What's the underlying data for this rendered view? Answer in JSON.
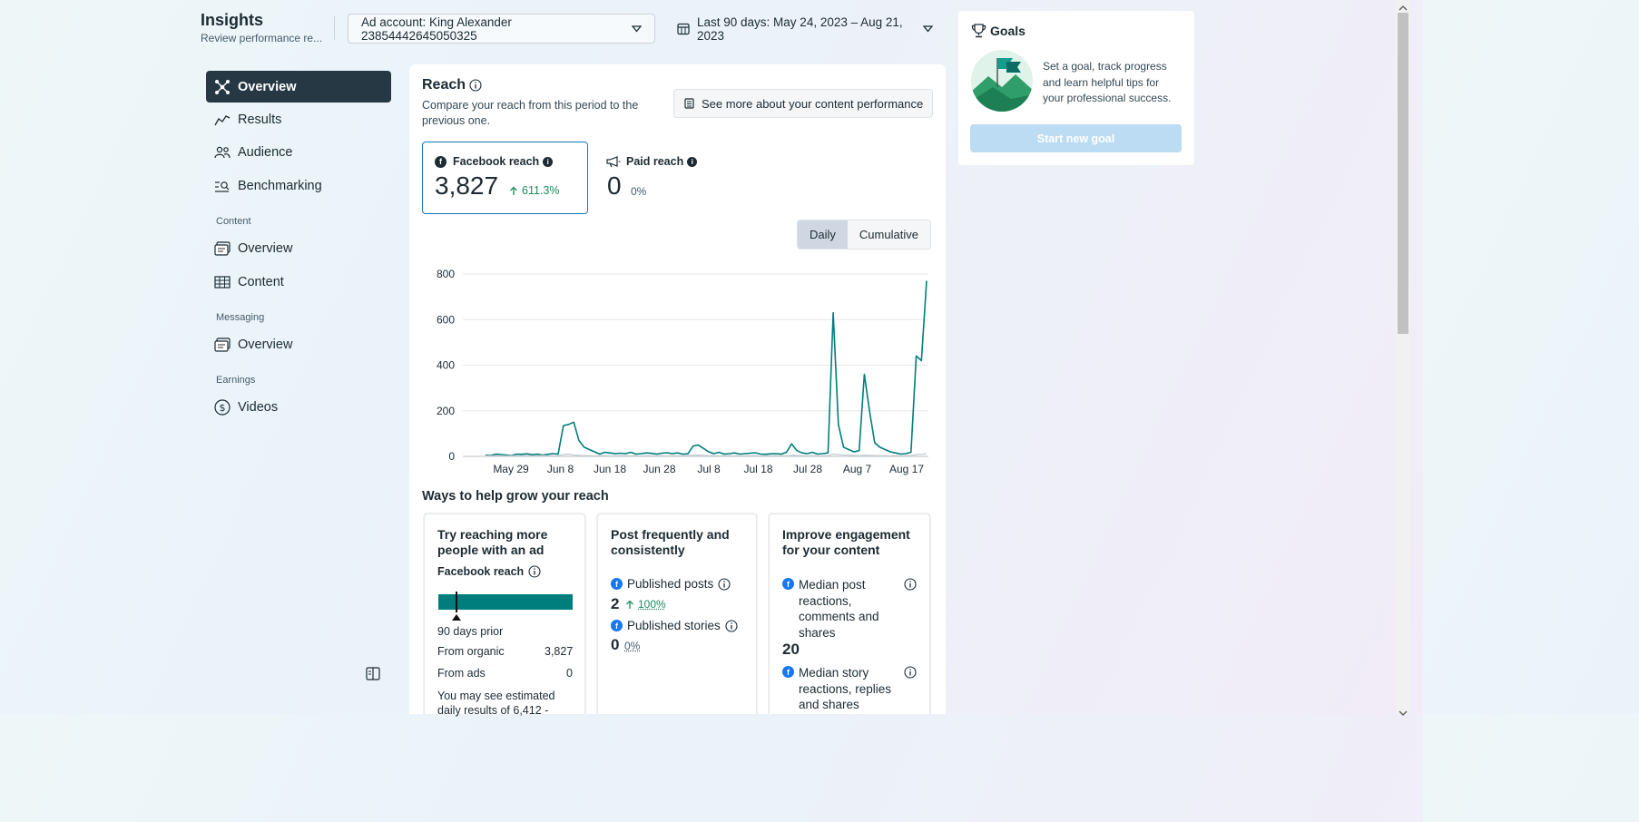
{
  "header": {
    "title": "Insights",
    "subtitle": "Review performance re...",
    "ad_account": "Ad account: King Alexander 23854442645050325",
    "date_range": "Last 90 days: May 24, 2023 – Aug 21, 2023"
  },
  "sidebar": {
    "items": [
      {
        "label": "Overview",
        "icon": "overview-icon"
      },
      {
        "label": "Results",
        "icon": "results-icon"
      },
      {
        "label": "Audience",
        "icon": "audience-icon"
      },
      {
        "label": "Benchmarking",
        "icon": "benchmarking-icon"
      }
    ],
    "content_heading": "Content",
    "content_items": [
      {
        "label": "Overview",
        "icon": "content-overview-icon"
      },
      {
        "label": "Content",
        "icon": "table-icon"
      }
    ],
    "messaging_heading": "Messaging",
    "messaging_items": [
      {
        "label": "Overview",
        "icon": "messaging-overview-icon"
      }
    ],
    "earnings_heading": "Earnings",
    "earnings_items": [
      {
        "label": "Videos",
        "icon": "dollar-icon"
      }
    ]
  },
  "reach": {
    "title": "Reach",
    "description": "Compare your reach from this period to the previous one.",
    "see_more": "See more about your content performance",
    "facebook_label": "Facebook reach",
    "facebook_value": "3,827",
    "facebook_change": "611.3%",
    "paid_label": "Paid reach",
    "paid_value": "0",
    "paid_change": "0%",
    "toggle": {
      "daily": "Daily",
      "cumulative": "Cumulative"
    }
  },
  "chart_data": {
    "type": "line",
    "x_ticks": [
      "May 29",
      "Jun 8",
      "Jun 18",
      "Jun 28",
      "Jul 8",
      "Jul 18",
      "Jul 28",
      "Aug 7",
      "Aug 17"
    ],
    "y_ticks": [
      "800",
      "600",
      "400",
      "200",
      "0"
    ],
    "ylim": [
      0,
      800
    ],
    "series": [
      {
        "color": "#007d7d",
        "values": [
          5,
          4,
          10,
          8,
          6,
          4,
          10,
          9,
          11,
          7,
          10,
          6,
          9,
          12,
          10,
          135,
          140,
          150,
          70,
          40,
          30,
          20,
          10,
          18,
          15,
          12,
          14,
          12,
          18,
          10,
          12,
          15,
          13,
          10,
          14,
          16,
          12,
          15,
          10,
          11,
          45,
          50,
          35,
          20,
          12,
          18,
          10,
          12,
          15,
          10,
          12,
          14,
          16,
          10,
          9,
          11,
          12,
          10,
          18,
          55,
          25,
          15,
          12,
          18,
          10,
          12,
          15,
          630,
          140,
          40,
          30,
          20,
          25,
          360,
          200,
          60,
          40,
          30,
          20,
          15,
          10,
          12,
          18,
          440,
          420,
          770
        ],
        "secondary": false
      },
      {
        "color": "#c5cbd1",
        "values": [
          2,
          2,
          3,
          3,
          2,
          3,
          2,
          3,
          3,
          2,
          3,
          4,
          3,
          2,
          3,
          8,
          10,
          6,
          4,
          3,
          3,
          2,
          3,
          3,
          2,
          3,
          3,
          3,
          2,
          3,
          2,
          3,
          2,
          3,
          3,
          2,
          3,
          2,
          3,
          3,
          5,
          6,
          4,
          3,
          3,
          2,
          3,
          3,
          2,
          3,
          2,
          3,
          3,
          2,
          3,
          2,
          3,
          3,
          2,
          5,
          4,
          3,
          2,
          3,
          3,
          2,
          3,
          10,
          8,
          6,
          5,
          4,
          3,
          5,
          4,
          3,
          3,
          3,
          2,
          3,
          2,
          3,
          3,
          8,
          9,
          12
        ],
        "secondary": true
      }
    ]
  },
  "grow": {
    "title": "Ways to help grow your reach",
    "card1": {
      "title": "Try reaching more people with an ad",
      "label": "Facebook reach",
      "bar_color": "#007d7d",
      "marker_label": "90 days prior",
      "organic_label": "From organic",
      "organic_value": "3,827",
      "ads_label": "From ads",
      "ads_value": "0",
      "note": "You may see estimated daily results of 6,412 -"
    },
    "card2": {
      "title": "Post frequently and consistently",
      "posts_label": "Published posts",
      "posts_value": "2",
      "posts_change": "100%",
      "stories_label": "Published stories",
      "stories_value": "0",
      "stories_change": "0%"
    },
    "card3": {
      "title": "Improve engagement for your content",
      "post_metric_label": "Median post reactions, comments and shares",
      "post_metric_value": "20",
      "story_metric_label": "Median story reactions, replies and shares"
    }
  },
  "goals": {
    "title": "Goals",
    "text": "Set a goal, track progress and learn helpful tips for your professional success.",
    "button": "Start new goal"
  }
}
